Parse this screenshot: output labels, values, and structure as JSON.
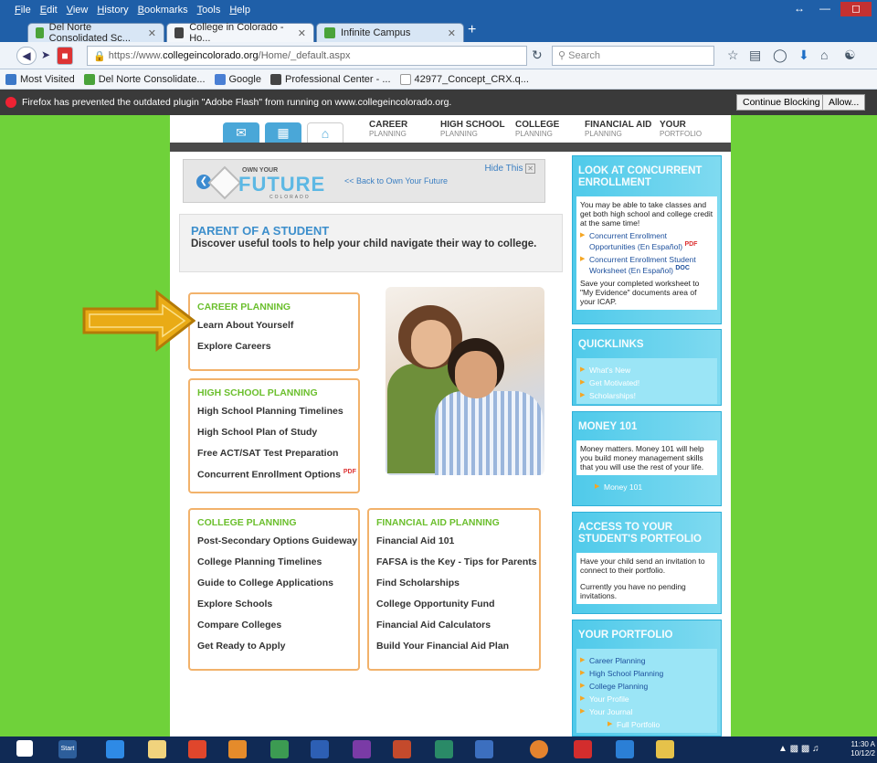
{
  "browser": {
    "menu": [
      "File",
      "Edit",
      "View",
      "History",
      "Bookmarks",
      "Tools",
      "Help"
    ],
    "tabs": [
      {
        "label": "Del Norte Consolidated Sc...",
        "close": "✕"
      },
      {
        "label": "College in Colorado - Ho...",
        "close": "✕"
      },
      {
        "label": "Infinite Campus",
        "close": "✕"
      }
    ],
    "new_tab": "+",
    "url_prefix": "https://www.",
    "url_host": "collegeincolorado.org",
    "url_path": "/Home/_default.aspx",
    "search_placeholder": "Search",
    "bookmarks": [
      "Most Visited",
      "Del Norte Consolidate...",
      "Google",
      "Professional Center - ...",
      "42977_Concept_CRX.q..."
    ],
    "plugin_msg": "Firefox has prevented the outdated plugin \"Adobe Flash\" from running on www.collegeincolorado.org.",
    "continue_blocking": "Continue Blocking",
    "allow": "Allow..."
  },
  "site_nav": [
    {
      "title": "CAREER",
      "sub": "PLANNING"
    },
    {
      "title": "HIGH SCHOOL",
      "sub": "PLANNING"
    },
    {
      "title": "COLLEGE",
      "sub": "PLANNING"
    },
    {
      "title": "FINANCIAL AID",
      "sub": "PLANNING"
    },
    {
      "title": "YOUR",
      "sub": "PORTFOLIO"
    }
  ],
  "hero": {
    "own_your": "OWN YOUR",
    "future": "FUTURE",
    "colorado": "COLORADO",
    "back_link": "<< Back to Own Your Future",
    "hide_this": "Hide This"
  },
  "parent": {
    "title": "PARENT OF A STUDENT",
    "subtitle": "Discover useful tools to help your child navigate their way to college."
  },
  "career": {
    "title": "CAREER PLANNING",
    "links": [
      "Learn About Yourself",
      "Explore Careers"
    ]
  },
  "highschool": {
    "title": "HIGH SCHOOL PLANNING",
    "links": [
      "High School Planning Timelines",
      "High School Plan of Study",
      "Free ACT/SAT Test Preparation",
      "Concurrent Enrollment Options"
    ],
    "pdf": "PDF"
  },
  "college": {
    "title": "COLLEGE PLANNING",
    "links": [
      "Post-Secondary Options Guideway",
      "College Planning Timelines",
      "Guide to College Applications",
      "Explore Schools",
      "Compare Colleges",
      "Get Ready to Apply"
    ]
  },
  "finaid": {
    "title": "FINANCIAL AID PLANNING",
    "links": [
      "Financial Aid 101",
      "FAFSA is the Key - Tips for Parents",
      "Find Scholarships",
      "College Opportunity Fund",
      "Financial Aid Calculators",
      "Build Your Financial Aid Plan"
    ]
  },
  "sidebar": {
    "concurrent": {
      "title": "LOOK AT CONCURRENT ENROLLMENT",
      "text": "You may be able to take classes and get both high school and college credit at the same time!",
      "links": [
        "Concurrent Enrollment Opportunities (En Español)",
        "Concurrent Enrollment Student Worksheet (En Español)"
      ],
      "pdf": "PDF",
      "doc": "DOC",
      "save": "Save your completed worksheet to \"My Evidence\" documents area of your ICAP."
    },
    "quicklinks": {
      "title": "QUICKLINKS",
      "links": [
        "What's New",
        "Get Motivated!",
        "Scholarships!"
      ]
    },
    "money": {
      "title": "MONEY 101",
      "text": "Money matters. Money 101 will help you build money management skills that you will use the rest of your life.",
      "link": "Money 101"
    },
    "access": {
      "title": "ACCESS TO YOUR STUDENT'S PORTFOLIO",
      "text1": "Have your child send an invitation to connect to their portfolio.",
      "text2": "Currently you have no pending invitations."
    },
    "portfolio": {
      "title": "YOUR PORTFOLIO",
      "links": [
        "Career Planning",
        "High School Planning",
        "College Planning",
        "Your Profile",
        "Your Journal"
      ],
      "full": "Full Portfolio"
    }
  },
  "taskbar": {
    "start": "Start",
    "time": "11:30 A",
    "date": "10/12/2"
  }
}
